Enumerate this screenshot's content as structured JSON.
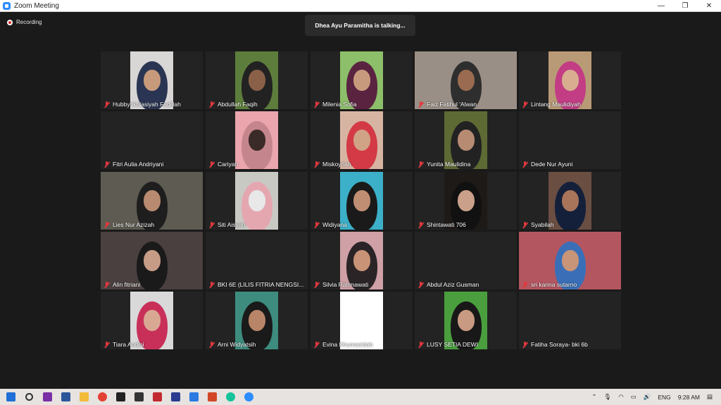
{
  "window": {
    "title": "Zoom Meeting"
  },
  "window_controls": {
    "minimize": "—",
    "restore": "❐",
    "close": "✕"
  },
  "status": {
    "recording": "Recording",
    "talking": "Dhea Ayu Paramitha is talking..."
  },
  "participants": [
    {
      "name": "Hubby Ikhlasiyah Fadillah",
      "video": true,
      "bg": "#d9d6d6",
      "hijab": "#2a3553",
      "face": "#c79a7c"
    },
    {
      "name": "Abdullah Faqih",
      "video": true,
      "bg": "#5d7d3c",
      "hijab": "#222222",
      "face": "#8a6048"
    },
    {
      "name": "Milenia Sofia",
      "video": true,
      "bg": "#8dbf6a",
      "hijab": "#5a2340",
      "face": "#c89a7d"
    },
    {
      "name": "Faiz Fatihul 'Alwan",
      "video": true,
      "bg": "#9a8f86",
      "hijab": "#2e2e2e",
      "face": "#9a6b50"
    },
    {
      "name": "Lintang Maulidiyah",
      "video": true,
      "bg": "#b99a76",
      "hijab": "#c23d84",
      "face": "#d8ad90"
    },
    {
      "name": "Fitri Aulia Andriyani",
      "video": false
    },
    {
      "name": "Cariyah",
      "video": true,
      "bg": "#eaa5ad",
      "hijab": "#c4868c",
      "face": "#3a2a28"
    },
    {
      "name": "Miskoyriah",
      "video": true,
      "bg": "#d7b4a2",
      "hijab": "#d33a45",
      "face": "#d0a286"
    },
    {
      "name": "Yunita Maulidina",
      "video": true,
      "bg": "#5e6a34",
      "hijab": "#222222",
      "face": "#b78b72"
    },
    {
      "name": "Dede Nur Ayuni",
      "video": false
    },
    {
      "name": "Lies Nur Azizah",
      "video": true,
      "bg": "#5d5b52",
      "hijab": "#1e1e1e",
      "face": "#b88a70"
    },
    {
      "name": "Siti Aisyah",
      "video": true,
      "bg": "#c9c9c4",
      "hijab": "#e4a7b0",
      "face": "#e8e8e8"
    },
    {
      "name": "Widiyana",
      "video": true,
      "bg": "#3bb0c8",
      "hijab": "#1a1a1a",
      "face": "#c08e72"
    },
    {
      "name": "Shintawati 706",
      "video": true,
      "bg": "#1e1a18",
      "hijab": "#111111",
      "face": "#caa08a"
    },
    {
      "name": "Syabilah",
      "video": true,
      "bg": "#6a4e42",
      "hijab": "#14203a",
      "face": "#a8745a"
    },
    {
      "name": "Alin fitriani",
      "video": true,
      "bg": "#4a4040",
      "hijab": "#1a1a1a",
      "face": "#c79c86"
    },
    {
      "name": "BKI 6E (LILIS FITRIA NENGSI...",
      "video": false
    },
    {
      "name": "Silvia Rahmawati",
      "video": true,
      "bg": "#cfa0a6",
      "hijab": "#2a2426",
      "face": "#c99378"
    },
    {
      "name": "Abdul Aziz Gusman",
      "video": false
    },
    {
      "name": "sri karina sutarno",
      "video": true,
      "bg": "#b45660",
      "hijab": "#3a6fb8",
      "face": "#c99578"
    },
    {
      "name": "Tiara Andini",
      "video": true,
      "bg": "#d9d9d9",
      "hijab": "#c8305a",
      "face": "#d9a892"
    },
    {
      "name": "Arni Widyatsih",
      "video": true,
      "bg": "#3d8c7e",
      "hijab": "#1a1a1a",
      "face": "#b88568"
    },
    {
      "name": "Evina Khumaeidah",
      "video": true,
      "bg": "#ffffff",
      "hijab": "#ffffff",
      "face": "#ffffff"
    },
    {
      "name": "LUSY SETIA DEWI",
      "video": true,
      "bg": "#4a9e3e",
      "hijab": "#181818",
      "face": "#c99a82"
    },
    {
      "name": "Fatiha Soraya- bki 6b",
      "video": false
    }
  ],
  "taskbar": {
    "apps": [
      {
        "icon": "windows-start-icon",
        "color": "#1f6fd6"
      },
      {
        "icon": "search-icon",
        "color": "#333333"
      },
      {
        "icon": "onenote-icon",
        "color": "#7a2fa6"
      },
      {
        "icon": "word-icon",
        "color": "#2b579a"
      },
      {
        "icon": "file-explorer-icon",
        "color": "#f2bb3a"
      },
      {
        "icon": "chrome-icon",
        "color": "#e34133"
      },
      {
        "icon": "notion-icon",
        "color": "#222222"
      },
      {
        "icon": "camera-app-icon",
        "color": "#333333"
      },
      {
        "icon": "gallery-app-icon",
        "color": "#c2292f"
      },
      {
        "icon": "slash-app-icon",
        "color": "#2a3b8f"
      },
      {
        "icon": "todo-icon",
        "color": "#2a7ae2"
      },
      {
        "icon": "powerpoint-icon",
        "color": "#d24726"
      },
      {
        "icon": "grammarly-icon",
        "color": "#15c39a"
      },
      {
        "icon": "zoom-icon",
        "color": "#2d8cff"
      }
    ],
    "tray": {
      "lang": "ENG",
      "time": "9:28 AM"
    }
  }
}
